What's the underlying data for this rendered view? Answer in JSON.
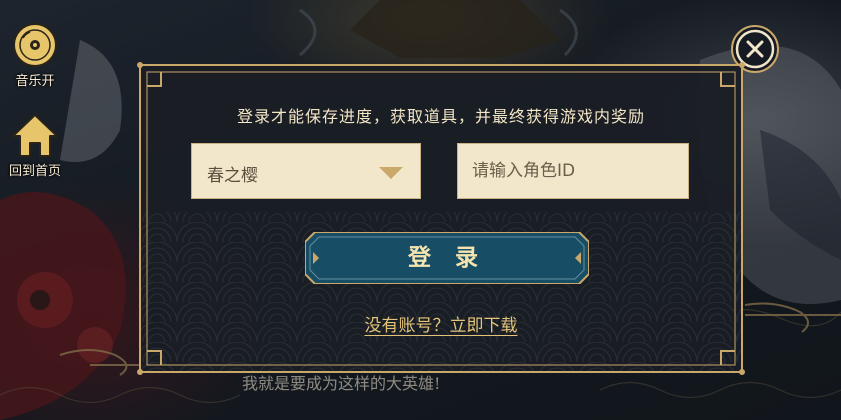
{
  "sidebar": {
    "music_label": "音乐开",
    "home_label": "回到首页"
  },
  "background": {
    "caption": "我就是要成为这样的大英雄!"
  },
  "dialog": {
    "instruction": "登录才能保存进度，获取道具，并最终获得游戏内奖励",
    "server_select_value": "春之樱",
    "role_id_placeholder": "请输入角色ID",
    "login_button_label": "登 录",
    "register_link_label": "没有账号？立即下载"
  },
  "colors": {
    "frame_gold": "#c9a86a",
    "dialog_bg": "#1a1d24",
    "input_bg": "#f3e7cb",
    "button_teal": "#174e66",
    "link_gold": "#e4c479"
  },
  "icons": {
    "music": "music-disc-icon",
    "home": "home-icon",
    "close": "close-icon",
    "dropdown": "dropdown-arrow-icon"
  }
}
